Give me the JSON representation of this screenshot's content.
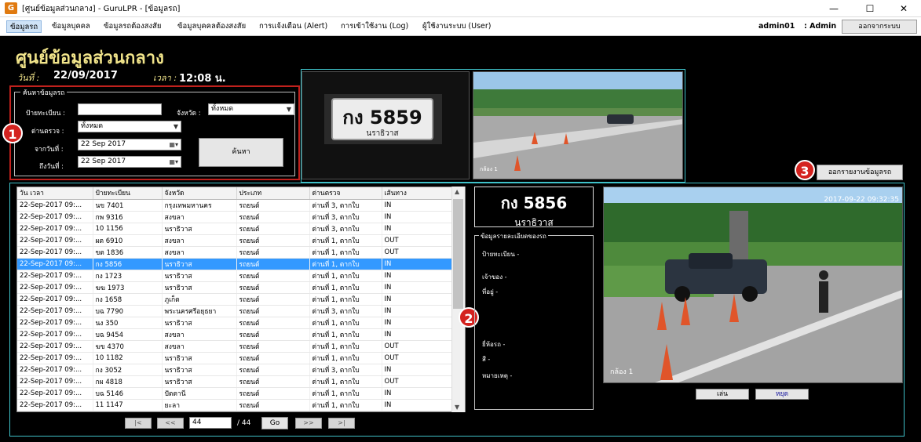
{
  "window": {
    "icon_letter": "G",
    "title": "[ศูนย์ข้อมูลส่วนกลาง] - GuruLPR - [ข้อมูลรถ]",
    "minimize": "—",
    "maximize": "☐",
    "close": "✕"
  },
  "menu": {
    "items": [
      {
        "label": "ข้อมูลรถ",
        "active": true
      },
      {
        "label": "ข้อมูลบุคคล"
      },
      {
        "label": "ข้อมูลรถต้องสงสัย"
      },
      {
        "label": "ข้อมูลบุคคลต้องสงสัย"
      },
      {
        "label": "การแจ้งเตือน (Alert)"
      },
      {
        "label": "การเข้าใช้งาน (Log)"
      },
      {
        "label": "ผู้ใช้งานระบบ (User)"
      }
    ],
    "user": "admin01",
    "role": ": Admin",
    "logout": "ออกจากระบบ"
  },
  "header": {
    "title": "ศูนย์ข้อมูลส่วนกลาง",
    "date_label": "วันที่ :",
    "date_value": "22/09/2017",
    "time_label": "เวลา :",
    "time_value": "12:08 น."
  },
  "search": {
    "legend": "ค้นหาข้อมูลรถ",
    "plate_label": "ป้ายทะเบียน :",
    "plate_value": "",
    "province_label": "จังหวัด :",
    "province_value": "ทั้งหมด",
    "checkpoint_label": "ด่านตรวจ :",
    "checkpoint_value": "ทั้งหมด",
    "from_label": "จากวันที่ :",
    "from_value": "22 Sep 2017",
    "to_label": "ถึงวันที่ :",
    "to_value": "22 Sep 2017",
    "button": "ค้นหา"
  },
  "markers": {
    "m1": "1",
    "m2": "2",
    "m3": "3"
  },
  "camera": {
    "plate_crop_top": "กง 5859",
    "plate_crop_bottom": "นราธิวาส",
    "scene_label": "กล้อง 1",
    "report_button": "ออกรายงานข้อมูลรถ",
    "big_timestamp": "2017-09-22 09:32:35",
    "big_label": "กล้อง 1",
    "play": "เล่น",
    "stop": "หยุด"
  },
  "table": {
    "columns": [
      "วัน เวลา",
      "ป้ายทะเบียน",
      "จังหวัด",
      "ประเภท",
      "ด่านตรวจ",
      "เส้นทาง"
    ],
    "rows": [
      [
        "22-Sep-2017 09:...",
        "นข 7401",
        "กรุงเทพมหานคร",
        "รถยนต์",
        "ด่านที่ 3, ตากใบ",
        "IN"
      ],
      [
        "22-Sep-2017 09:...",
        "กพ 9316",
        "สงขลา",
        "รถยนต์",
        "ด่านที่ 3, ตากใบ",
        "IN"
      ],
      [
        "22-Sep-2017 09:...",
        "10 1156",
        "นราธิวาส",
        "รถยนต์",
        "ด่านที่ 3, ตากใบ",
        "IN"
      ],
      [
        "22-Sep-2017 09:...",
        "ผต 6910",
        "สงขลา",
        "รถยนต์",
        "ด่านที่ 1, ตากใบ",
        "OUT"
      ],
      [
        "22-Sep-2017 09:...",
        "ขต 1836",
        "สงขลา",
        "รถยนต์",
        "ด่านที่ 1, ตากใบ",
        "OUT"
      ],
      [
        "22-Sep-2017 09:...",
        "กง 5856",
        "นราธิวาส",
        "รถยนต์",
        "ด่านที่ 1, ตากใบ",
        "IN"
      ],
      [
        "22-Sep-2017 09:...",
        "กง 1723",
        "นราธิวาส",
        "รถยนต์",
        "ด่านที่ 1, ตากใบ",
        "IN"
      ],
      [
        "22-Sep-2017 09:...",
        "ฆฆ 1973",
        "นราธิวาส",
        "รถยนต์",
        "ด่านที่ 1, ตากใบ",
        "IN"
      ],
      [
        "22-Sep-2017 09:...",
        "กง 1658",
        "ภูเก็ต",
        "รถยนต์",
        "ด่านที่ 1, ตากใบ",
        "IN"
      ],
      [
        "22-Sep-2017 09:...",
        "บฉ 7790",
        "พระนครศรีอยุธยา",
        "รถยนต์",
        "ด่านที่ 3, ตากใบ",
        "IN"
      ],
      [
        "22-Sep-2017 09:...",
        "นง 350",
        "นราธิวาส",
        "รถยนต์",
        "ด่านที่ 1, ตากใบ",
        "IN"
      ],
      [
        "22-Sep-2017 09:...",
        "บฉ 9454",
        "สงขลา",
        "รถยนต์",
        "ด่านที่ 1, ตากใบ",
        "IN"
      ],
      [
        "22-Sep-2017 09:...",
        "ฆข 4370",
        "สงขลา",
        "รถยนต์",
        "ด่านที่ 1, ตากใบ",
        "OUT"
      ],
      [
        "22-Sep-2017 09:...",
        "10 1182",
        "นราธิวาส",
        "รถยนต์",
        "ด่านที่ 1, ตากใบ",
        "OUT"
      ],
      [
        "22-Sep-2017 09:...",
        "กง 3052",
        "นราธิวาส",
        "รถยนต์",
        "ด่านที่ 3, ตากใบ",
        "IN"
      ],
      [
        "22-Sep-2017 09:...",
        "กผ 4818",
        "นราธิวาส",
        "รถยนต์",
        "ด่านที่ 1, ตากใบ",
        "OUT"
      ],
      [
        "22-Sep-2017 09:...",
        "บฉ 5146",
        "ปัตตานี",
        "รถยนต์",
        "ด่านที่ 1, ตากใบ",
        "IN"
      ],
      [
        "22-Sep-2017 09:...",
        "11 1147",
        "ยะลา",
        "รถยนต์",
        "ด่านที่ 1, ตากใบ",
        "IN"
      ]
    ],
    "selected_index": 5
  },
  "pager": {
    "first": "|<",
    "prev": "<<",
    "current": "44",
    "total": "/ 44",
    "go": "Go",
    "next": ">>",
    "last": ">|"
  },
  "plate_display": {
    "number": "กง 5856",
    "province": "นราธิวาส"
  },
  "details": {
    "legend": "ข้อมูลรายละเอียดของรถ",
    "plate": "ป้ายทะเบียน          -",
    "owner": "เจ้าของ    -",
    "address": "ที่อยู่    -",
    "brand": "ยี่ห้อรถ    -",
    "color": "สี    -",
    "note": "หมายเหตุ    -"
  }
}
